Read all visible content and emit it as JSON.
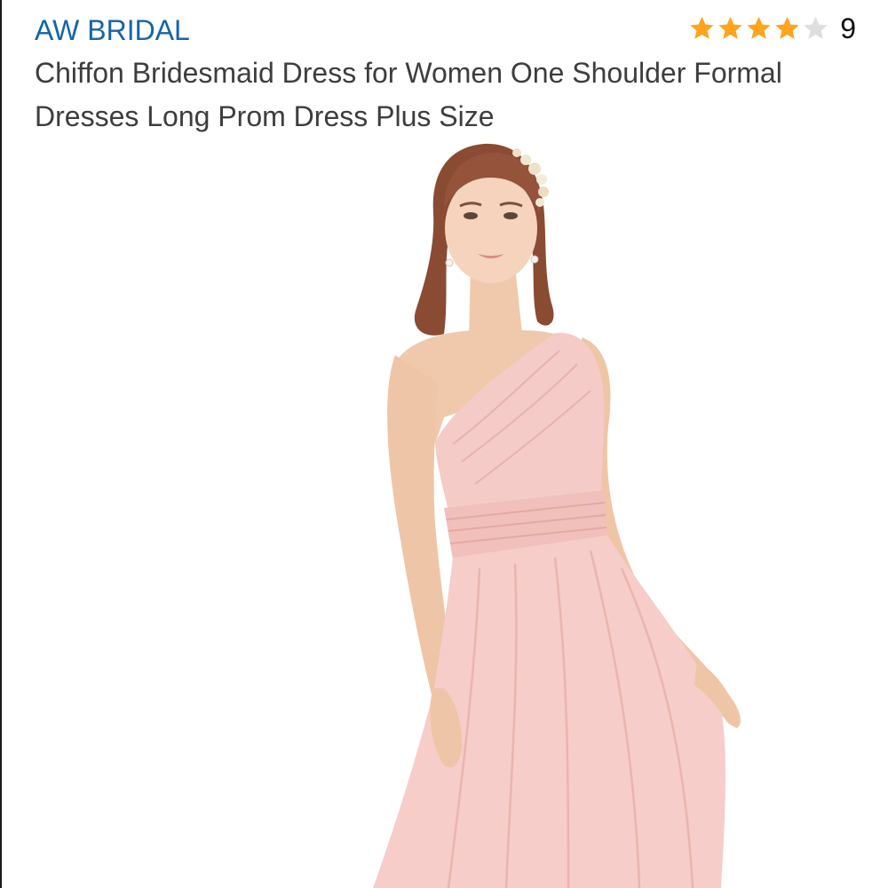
{
  "product": {
    "brand": "AW BRIDAL",
    "title": "Chiffon Bridesmaid Dress for Women One Shoulder Formal Dresses Long Prom Dress Plus Size",
    "rating": {
      "stars": 4,
      "max_stars": 5,
      "count": "9"
    },
    "image_icon": "product-photo-pink-one-shoulder-dress"
  },
  "colors": {
    "brand_link": "#1565a8",
    "title_text": "#3d3d3d",
    "star_filled": "#ffa41c",
    "star_empty": "#dedede",
    "dress": "#f4c6c3"
  }
}
